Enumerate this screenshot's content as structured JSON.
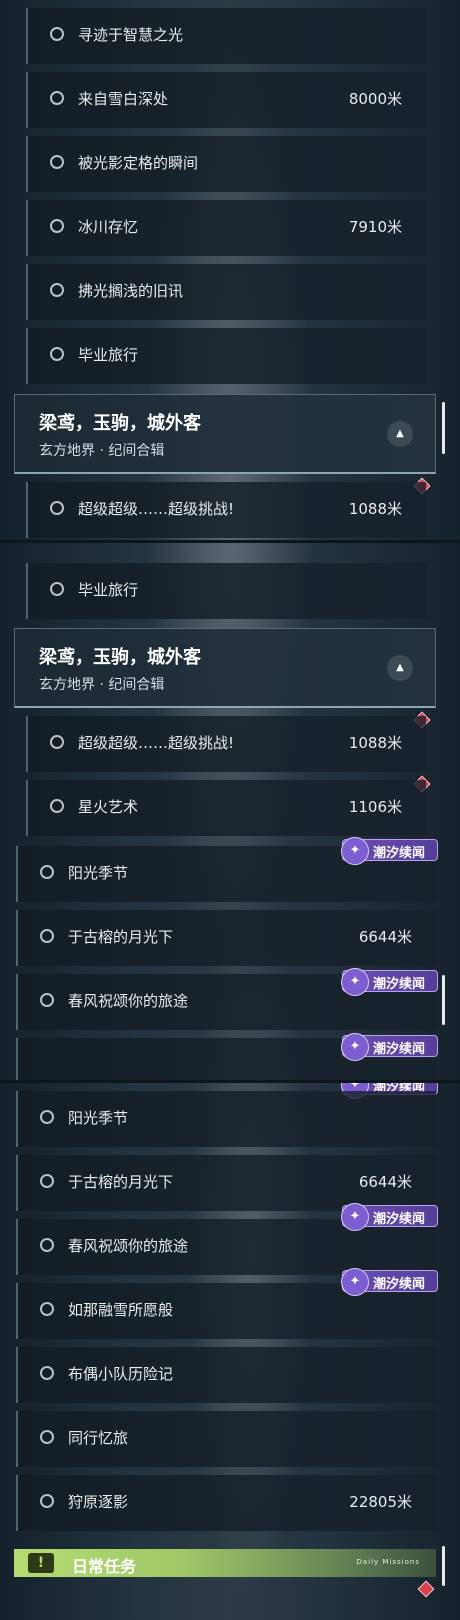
{
  "segment1": {
    "rows": [
      {
        "name": "寻迹于智慧之光",
        "dist": ""
      },
      {
        "name": "来自雪白深处",
        "dist": "8000米"
      },
      {
        "name": "被光影定格的瞬间",
        "dist": ""
      },
      {
        "name": "冰川存忆",
        "dist": "7910米"
      },
      {
        "name": "拂光搁浅的旧讯",
        "dist": ""
      },
      {
        "name": "毕业旅行",
        "dist": ""
      }
    ],
    "header": {
      "title": "梁鸢，玉驹，城外客",
      "subtitle": "玄方地界 · 纪间合辑"
    },
    "after": [
      {
        "name": "超级超级……超级挑战!",
        "dist": "1088米"
      }
    ]
  },
  "segment2": {
    "rows": [
      {
        "name": "毕业旅行",
        "dist": ""
      }
    ],
    "header": {
      "title": "梁鸢，玉驹，城外客",
      "subtitle": "玄方地界 · 纪间合辑"
    },
    "after": [
      {
        "name": "超级超级……超级挑战!",
        "dist": "1088米"
      },
      {
        "name": "星火艺术",
        "dist": "1106米"
      }
    ],
    "outer": [
      {
        "name": "阳光季节",
        "dist": ""
      },
      {
        "name": "于古榕的月光下",
        "dist": "6644米"
      },
      {
        "name": "春风祝颂你的旅途",
        "dist": ""
      }
    ]
  },
  "segment3": {
    "outer": [
      {
        "name": "阳光季节",
        "dist": ""
      },
      {
        "name": "于古榕的月光下",
        "dist": "6644米"
      },
      {
        "name": "春风祝颂你的旅途",
        "dist": ""
      },
      {
        "name": "如那融雪所愿般",
        "dist": ""
      },
      {
        "name": "布偶小队历险记",
        "dist": ""
      },
      {
        "name": "同行忆旅",
        "dist": ""
      },
      {
        "name": "狩原逐影",
        "dist": "22805米"
      }
    ]
  },
  "badge_label": "潮汐续闻",
  "daily": {
    "icon": "!",
    "label": "日常任务",
    "small": "Daily Missions"
  },
  "toggle_icon": "▲",
  "colors": {
    "badge": "#6c4fb3",
    "diamond": "#d8404f",
    "daily": "#b5db72"
  }
}
